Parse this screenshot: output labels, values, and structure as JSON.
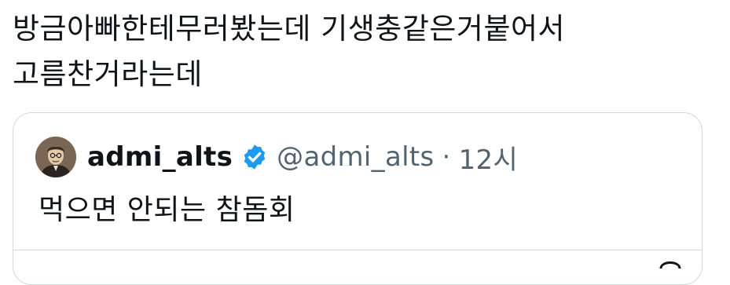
{
  "tweet": {
    "text_lines": [
      "방금아빠한테무러봤는데 기생충같은거붙어서",
      "고름찬거라는데"
    ]
  },
  "quote": {
    "display_name": "admi_alts",
    "handle": "@admi_alts",
    "separator": "·",
    "time": "12시",
    "text": "먹으면 안되는 참돔회",
    "verified": true,
    "icons": {
      "verified": "verified-badge-icon",
      "avatar": "avatar-illustration"
    },
    "colors": {
      "verified_badge": "#1d9bf0",
      "secondary_text": "#536471",
      "border": "#cfd9de"
    }
  }
}
